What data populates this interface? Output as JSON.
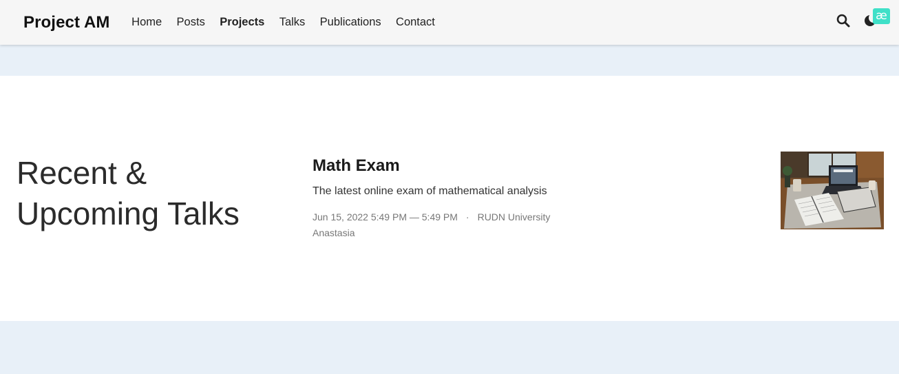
{
  "navbar": {
    "brand": "Project AM",
    "items": [
      {
        "label": "Home",
        "active": false
      },
      {
        "label": "Posts",
        "active": false
      },
      {
        "label": "Projects",
        "active": true
      },
      {
        "label": "Talks",
        "active": false
      },
      {
        "label": "Publications",
        "active": false
      },
      {
        "label": "Contact",
        "active": false
      }
    ],
    "icons": {
      "search": "search-icon",
      "theme": "moon-icon"
    },
    "badge": "æ"
  },
  "section": {
    "title_line1": "Recent &",
    "title_line2": "Upcoming Talks"
  },
  "talk": {
    "title": "Math Exam",
    "summary": "The latest online exam of mathematical analysis",
    "datetime": "Jun 15, 2022 5:49 PM — 5:49 PM",
    "separator": "·",
    "location": "RUDN University",
    "author": "Anastasia",
    "thumbnail": "desk-with-laptop-and-notebook-image"
  },
  "colors": {
    "page_background": "#e8f0f8",
    "navbar_background": "#f6f6f6",
    "badge": "#3fe0c8"
  }
}
